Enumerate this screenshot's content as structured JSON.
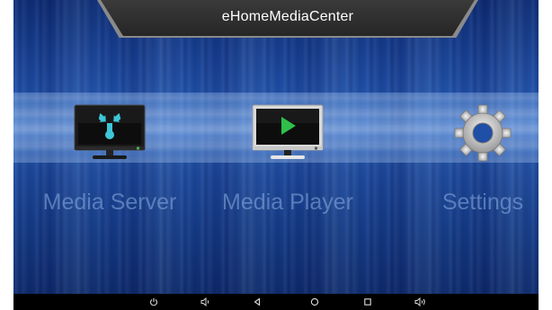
{
  "app": {
    "title": "eHomeMediaCenter"
  },
  "tiles": [
    {
      "label": "Media Server",
      "icon": "media-server-monitor-icon"
    },
    {
      "label": "Media Player",
      "icon": "media-player-monitor-icon"
    },
    {
      "label": "Settings",
      "icon": "gear-icon"
    }
  ],
  "navbar": {
    "buttons": [
      "power-icon",
      "volume-down-icon",
      "back-icon",
      "home-icon",
      "recents-icon",
      "volume-up-icon"
    ]
  },
  "colors": {
    "background": "#1a3f8c",
    "title_bar": "#2e2e2e",
    "label_text": "#8cafe1",
    "accent_teal": "#3ec6d8",
    "accent_green": "#2fbf4a"
  }
}
